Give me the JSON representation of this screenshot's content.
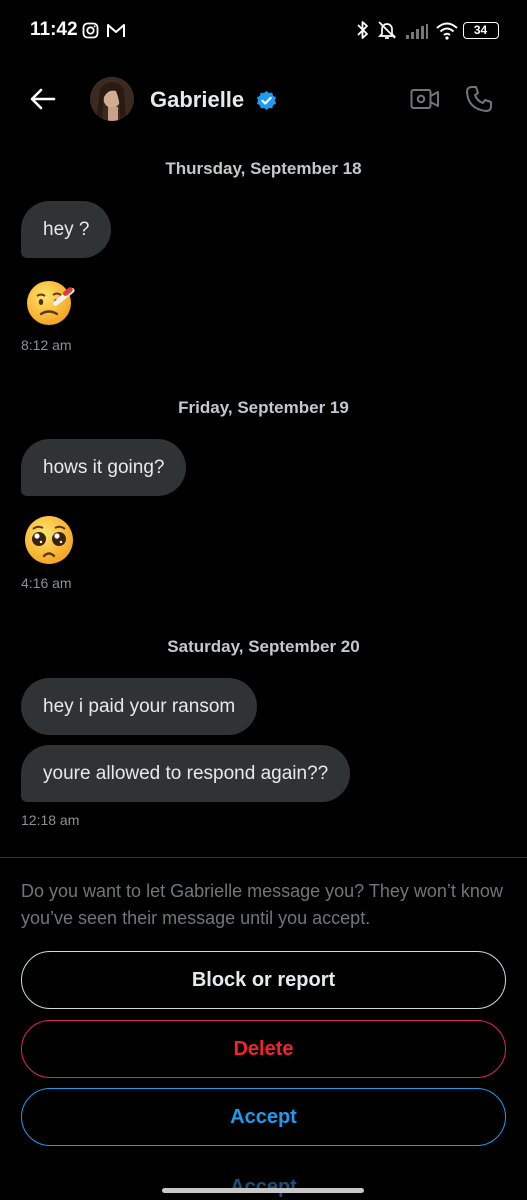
{
  "status_bar": {
    "time": "11:42",
    "battery": "34",
    "icons": [
      "instagram-icon",
      "gmail-icon",
      "bluetooth-icon",
      "mute-icon",
      "signal-icon",
      "wifi-icon",
      "battery-icon"
    ]
  },
  "header": {
    "name": "Gabrielle",
    "verified": true,
    "icons": [
      "back-arrow-icon",
      "video-call-icon",
      "phone-icon"
    ]
  },
  "conversation": {
    "groups": [
      {
        "date": "Thursday, September 18",
        "messages": [
          "hey ?"
        ],
        "emoji": "face-with-thermometer",
        "time": "8:12 am"
      },
      {
        "date": "Friday, September 19",
        "messages": [
          "hows it going?"
        ],
        "emoji": "pleading-face",
        "time": "4:16 am"
      },
      {
        "date": "Saturday, September 20",
        "messages": [
          "hey i paid your ransom",
          "youre allowed to respond again??"
        ],
        "time": "12:18 am"
      }
    ]
  },
  "request": {
    "prompt": "Do you want to let Gabrielle message you? They won’t know you’ve seen their message until you accept.",
    "block_label": "Block or report",
    "delete_label": "Delete",
    "accept_label": "Accept"
  },
  "colors": {
    "background": "#000000",
    "bubble": "#2f3336",
    "accent_blue": "#1d9bf0",
    "danger_red": "#f4212e"
  }
}
